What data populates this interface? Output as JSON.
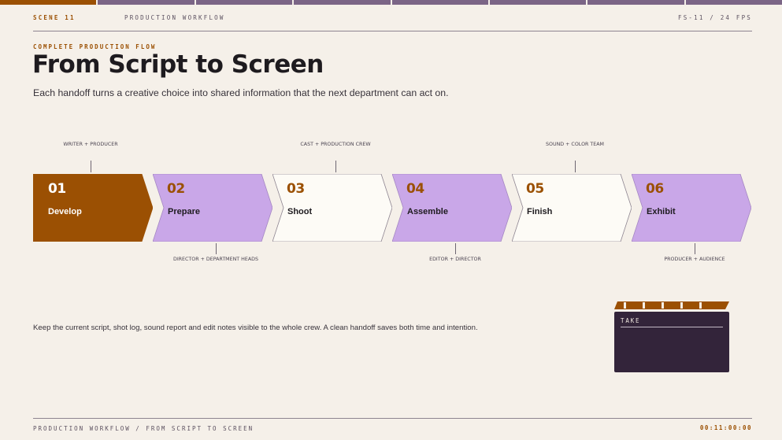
{
  "progress": {
    "total_segments": 8,
    "current_segment": 1
  },
  "header": {
    "scene": "SCENE 11",
    "section": "PRODUCTION WORKFLOW",
    "fps": "FS-11 / 24 FPS"
  },
  "eyebrow": "COMPLETE PRODUCTION FLOW",
  "title": "From Script to Screen",
  "subtitle": "Each handoff turns a creative choice into shared information that the next department can act on.",
  "stages": [
    {
      "number": "01",
      "name": "Develop",
      "role": "WRITER + PRODUCER",
      "role_position": "above",
      "fill": "#9b5003",
      "text": "#ffffff"
    },
    {
      "number": "02",
      "name": "Prepare",
      "role": "DIRECTOR + DEPARTMENT HEADS",
      "role_position": "below",
      "fill": "#c9a7e8",
      "text": "#1e1b1f"
    },
    {
      "number": "03",
      "name": "Shoot",
      "role": "CAST + PRODUCTION CREW",
      "role_position": "above",
      "fill": "#fdfbf6",
      "text": "#1e1b1f"
    },
    {
      "number": "04",
      "name": "Assemble",
      "role": "EDITOR + DIRECTOR",
      "role_position": "below",
      "fill": "#c9a7e8",
      "text": "#1e1b1f"
    },
    {
      "number": "05",
      "name": "Finish",
      "role": "SOUND + COLOR TEAM",
      "role_position": "above",
      "fill": "#fdfbf6",
      "text": "#1e1b1f"
    },
    {
      "number": "06",
      "name": "Exhibit",
      "role": "PRODUCER + AUDIENCE",
      "role_position": "below",
      "fill": "#c9a7e8",
      "text": "#1e1b1f"
    }
  ],
  "note": "Keep the current script, shot log, sound report and edit notes visible to the whole crew. A clean handoff saves both time and intention.",
  "clapper": {
    "label": "TAKE"
  },
  "footer": {
    "text": "PRODUCTION WORKFLOW / FROM SCRIPT TO SCREEN",
    "timecode": "00:11:00:00"
  },
  "colors": {
    "accent": "#9b5003",
    "lavender": "#c9a7e8",
    "cream": "#fdfbf6",
    "plum": "#33243a",
    "progress": "#7b6586",
    "background": "#f5f0e9"
  }
}
